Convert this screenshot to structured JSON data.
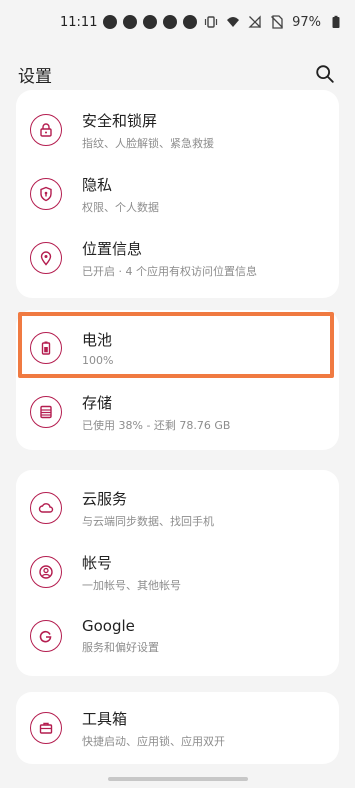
{
  "status": {
    "time": "11:11",
    "battery": "97%",
    "icons_left": [
      "notif-1",
      "notif-2",
      "notif-3",
      "notif-4",
      "notif-5"
    ],
    "icons_right": [
      "vibrate-icon",
      "wifi-icon",
      "no-signal-icon",
      "no-sim-icon",
      "battery-icon"
    ]
  },
  "header": {
    "title": "设置",
    "search_icon": "search-icon"
  },
  "accent_color": "#b41d4f",
  "highlight_color": "#f07a41",
  "cards": [
    {
      "items": [
        {
          "title": "安全和锁屏",
          "subtitle": "指纹、人脸解锁、紧急救援",
          "icon": "lock-icon"
        },
        {
          "title": "隐私",
          "subtitle": "权限、个人数据",
          "icon": "privacy-shield-icon"
        },
        {
          "title": "位置信息",
          "subtitle": "已开启 · 4 个应用有权访问位置信息",
          "icon": "location-pin-icon"
        }
      ]
    },
    {
      "items": [
        {
          "title": "电池",
          "subtitle": "100%",
          "icon": "battery-icon"
        },
        {
          "title": "存储",
          "subtitle": "已使用 38% - 还剩 78.76 GB",
          "icon": "storage-icon"
        }
      ]
    },
    {
      "items": [
        {
          "title": "云服务",
          "subtitle": "与云端同步数据、找回手机",
          "icon": "cloud-icon"
        },
        {
          "title": "帐号",
          "subtitle": "一加帐号、其他帐号",
          "icon": "account-icon"
        },
        {
          "title": "Google",
          "subtitle": "服务和偏好设置",
          "icon": "google-icon"
        }
      ]
    },
    {
      "items": [
        {
          "title": "工具箱",
          "subtitle": "快捷启动、应用锁、应用双开",
          "icon": "toolbox-icon"
        }
      ]
    }
  ]
}
